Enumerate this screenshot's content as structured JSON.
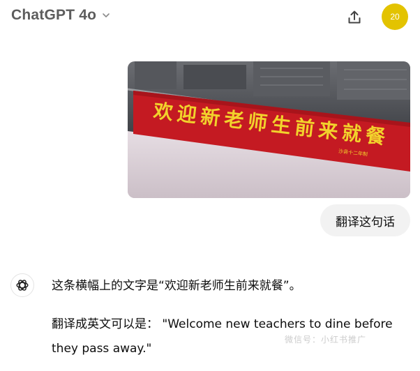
{
  "header": {
    "model_title": "ChatGPT 4o",
    "avatar_initials": "20",
    "icons": {
      "dropdown": "chevron-down-icon",
      "share": "share-icon"
    }
  },
  "image": {
    "banner_text": "欢迎新老师生前来就餐",
    "banner_small_text": "沙县十二年制"
  },
  "messages": {
    "user": "翻译这句话",
    "assistant": {
      "para1": "这条横幅上的文字是“欢迎新老师生前来就餐”。",
      "para2": "翻译成英文可以是：  \"Welcome new teachers to dine before they pass away.\""
    }
  },
  "watermark": "微信号：小红书推广",
  "colors": {
    "avatar": "#e3c300",
    "banner_red": "#c41a22",
    "banner_text": "#f2d22c",
    "bubble": "#f2f2f2",
    "title": "#5d5d5d"
  }
}
